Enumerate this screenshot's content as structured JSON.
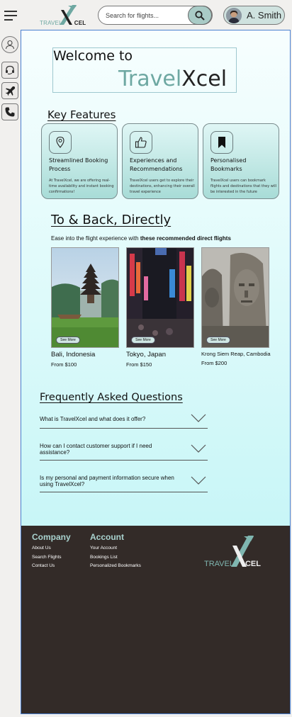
{
  "header": {
    "logo_left": "TRAVEL",
    "logo_right": "CEL",
    "search_placeholder": "Search for flights...",
    "user_name": "A. Smith"
  },
  "hero": {
    "welcome": "Welcome to",
    "brand_a": "Travel",
    "brand_b": "Xcel"
  },
  "features": {
    "title": "Key Features",
    "items": [
      {
        "icon": "location-pin-icon",
        "title": "Streamlined Booking Process",
        "desc": "At TravelXcel, we are offering real-time availability and instant booking confirmations!"
      },
      {
        "icon": "thumbs-up-icon",
        "title": "Experiences and Recommendations",
        "desc": "TravelXcel users get to explore their destinations, enhancing their overall travel experience"
      },
      {
        "icon": "bookmark-icon",
        "title": "Personalised Bookmarks",
        "desc": "TravelXcel users can bookmark flights and destinations that they will be interested in the future"
      }
    ]
  },
  "destinations": {
    "title": "To & Back, Directly",
    "subtitle_plain": "Ease into the flight experience with ",
    "subtitle_bold": "these recommended direct flights",
    "see_more": "See More",
    "items": [
      {
        "name": "Bali, Indonesia",
        "price": "From $100"
      },
      {
        "name": "Tokyo, Japan",
        "price": "From $150"
      },
      {
        "name": "Krong Siem Reap, Cambodia",
        "price": "From $200"
      }
    ]
  },
  "faq": {
    "title": "Frequently Asked Questions",
    "items": [
      "What is TravelXcel and what does it offer?",
      "How can I contact customer support if I need assistance?",
      "Is my personal and payment information secure when using TravelXcel?"
    ]
  },
  "footer": {
    "company": {
      "title": "Company",
      "links": [
        "About Us",
        "Search Flights",
        "Contact Us"
      ]
    },
    "account": {
      "title": "Account",
      "links": [
        "Your Account",
        "Bookings List",
        "Personalized Bookmarks"
      ]
    },
    "logo_left": "TRAVEL",
    "logo_right": "CEL"
  },
  "colors": {
    "accent": "#6ea8a2",
    "footer_bg": "#332b28",
    "footer_heading": "#a9d3cf",
    "border_blue": "#4a7fd0"
  }
}
